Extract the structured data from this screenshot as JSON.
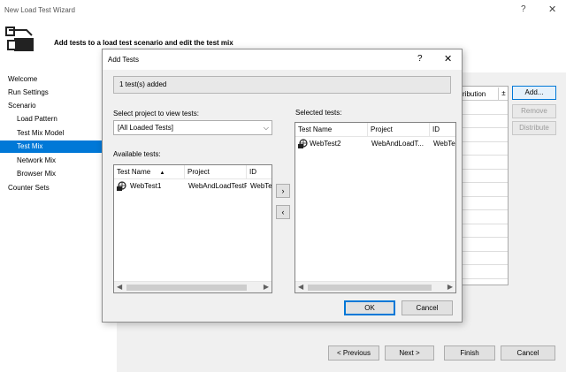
{
  "window": {
    "title": "New Load Test Wizard",
    "help": "?",
    "close": "✕"
  },
  "header": {
    "text": "Add tests to a load test scenario and edit the test mix",
    "icon": "wizard-icon"
  },
  "nav": {
    "items": [
      {
        "label": "Welcome",
        "level": "top",
        "selected": false
      },
      {
        "label": "Run Settings",
        "level": "top",
        "selected": false
      },
      {
        "label": "Scenario",
        "level": "top",
        "selected": false
      },
      {
        "label": "Load Pattern",
        "level": "sub",
        "selected": false
      },
      {
        "label": "Test Mix Model",
        "level": "sub",
        "selected": false
      },
      {
        "label": "Test Mix",
        "level": "sub",
        "selected": true
      },
      {
        "label": "Network Mix",
        "level": "sub",
        "selected": false
      },
      {
        "label": "Browser Mix",
        "level": "sub",
        "selected": false
      },
      {
        "label": "Counter Sets",
        "level": "top",
        "selected": false
      }
    ]
  },
  "mix_grid": {
    "col1": "istribution",
    "col2": "±"
  },
  "right_buttons": {
    "add": "Add...",
    "remove": "Remove",
    "distribute": "Distribute"
  },
  "bottom_buttons": {
    "previous": "< Previous",
    "next": "Next >",
    "finish": "Finish",
    "cancel": "Cancel"
  },
  "dialog": {
    "title": "Add Tests",
    "help": "?",
    "close": "✕",
    "status": "1 test(s) added",
    "project_label": "Select project to view tests:",
    "project_value": "[All Loaded Tests]",
    "available_label": "Available tests:",
    "selected_label": "Selected tests:",
    "available": {
      "columns": [
        "Test Name",
        "Project",
        "ID"
      ],
      "sort_indicator": "▲",
      "rows": [
        {
          "name": "WebTest1",
          "project": "WebAndLoadTestP",
          "id": "WebTe"
        }
      ]
    },
    "selected": {
      "columns": [
        "Test Name",
        "Project",
        "ID"
      ],
      "rows": [
        {
          "name": "WebTest2",
          "project": "WebAndLoadT...",
          "id": "WebTe"
        }
      ]
    },
    "move_right": "›",
    "move_left": "‹",
    "ok": "OK",
    "cancel": "Cancel"
  }
}
